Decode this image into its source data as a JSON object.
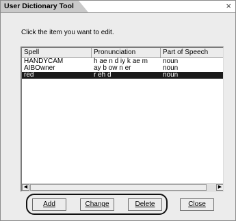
{
  "window": {
    "title": "User Dictionary Tool",
    "close_glyph": "×"
  },
  "instruction": "Click the item you want to edit.",
  "list": {
    "columns": [
      "Spell",
      "Pronunciation",
      "Part of Speech"
    ],
    "rows": [
      {
        "spell": "HANDYCAM",
        "pronunciation": "h ae n d iy k ae m",
        "pos": "noun",
        "selected": false
      },
      {
        "spell": "AIBOwner",
        "pronunciation": "ay b ow n er",
        "pos": "noun",
        "selected": false
      },
      {
        "spell": "red",
        "pronunciation": "r eh d",
        "pos": "noun",
        "selected": true
      }
    ]
  },
  "scrollbar": {
    "left_arrow": "◀",
    "right_arrow": "▶"
  },
  "buttons": {
    "add": "Add",
    "change": "Change",
    "delete": "Delete",
    "close": "Close"
  },
  "colors": {
    "selection": "#1a1a1a",
    "dialog_bg": "#ececec",
    "title_tab": "#c9c9c9"
  }
}
